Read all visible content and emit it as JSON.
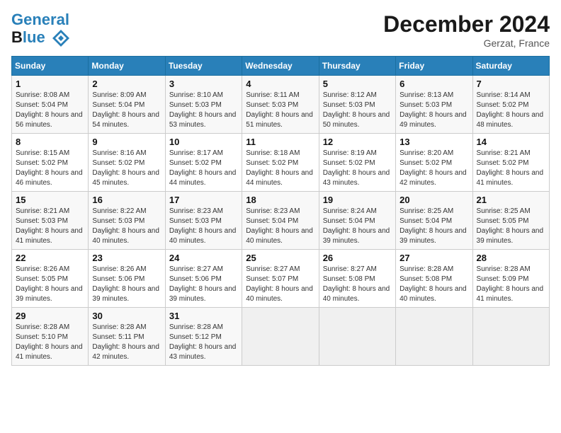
{
  "header": {
    "logo_line1": "General",
    "logo_line2": "Blue",
    "title": "December 2024",
    "subtitle": "Gerzat, France"
  },
  "weekdays": [
    "Sunday",
    "Monday",
    "Tuesday",
    "Wednesday",
    "Thursday",
    "Friday",
    "Saturday"
  ],
  "weeks": [
    [
      {
        "day": "1",
        "sunrise": "Sunrise: 8:08 AM",
        "sunset": "Sunset: 5:04 PM",
        "daylight": "Daylight: 8 hours and 56 minutes."
      },
      {
        "day": "2",
        "sunrise": "Sunrise: 8:09 AM",
        "sunset": "Sunset: 5:04 PM",
        "daylight": "Daylight: 8 hours and 54 minutes."
      },
      {
        "day": "3",
        "sunrise": "Sunrise: 8:10 AM",
        "sunset": "Sunset: 5:03 PM",
        "daylight": "Daylight: 8 hours and 53 minutes."
      },
      {
        "day": "4",
        "sunrise": "Sunrise: 8:11 AM",
        "sunset": "Sunset: 5:03 PM",
        "daylight": "Daylight: 8 hours and 51 minutes."
      },
      {
        "day": "5",
        "sunrise": "Sunrise: 8:12 AM",
        "sunset": "Sunset: 5:03 PM",
        "daylight": "Daylight: 8 hours and 50 minutes."
      },
      {
        "day": "6",
        "sunrise": "Sunrise: 8:13 AM",
        "sunset": "Sunset: 5:03 PM",
        "daylight": "Daylight: 8 hours and 49 minutes."
      },
      {
        "day": "7",
        "sunrise": "Sunrise: 8:14 AM",
        "sunset": "Sunset: 5:02 PM",
        "daylight": "Daylight: 8 hours and 48 minutes."
      }
    ],
    [
      {
        "day": "8",
        "sunrise": "Sunrise: 8:15 AM",
        "sunset": "Sunset: 5:02 PM",
        "daylight": "Daylight: 8 hours and 46 minutes."
      },
      {
        "day": "9",
        "sunrise": "Sunrise: 8:16 AM",
        "sunset": "Sunset: 5:02 PM",
        "daylight": "Daylight: 8 hours and 45 minutes."
      },
      {
        "day": "10",
        "sunrise": "Sunrise: 8:17 AM",
        "sunset": "Sunset: 5:02 PM",
        "daylight": "Daylight: 8 hours and 44 minutes."
      },
      {
        "day": "11",
        "sunrise": "Sunrise: 8:18 AM",
        "sunset": "Sunset: 5:02 PM",
        "daylight": "Daylight: 8 hours and 44 minutes."
      },
      {
        "day": "12",
        "sunrise": "Sunrise: 8:19 AM",
        "sunset": "Sunset: 5:02 PM",
        "daylight": "Daylight: 8 hours and 43 minutes."
      },
      {
        "day": "13",
        "sunrise": "Sunrise: 8:20 AM",
        "sunset": "Sunset: 5:02 PM",
        "daylight": "Daylight: 8 hours and 42 minutes."
      },
      {
        "day": "14",
        "sunrise": "Sunrise: 8:21 AM",
        "sunset": "Sunset: 5:02 PM",
        "daylight": "Daylight: 8 hours and 41 minutes."
      }
    ],
    [
      {
        "day": "15",
        "sunrise": "Sunrise: 8:21 AM",
        "sunset": "Sunset: 5:03 PM",
        "daylight": "Daylight: 8 hours and 41 minutes."
      },
      {
        "day": "16",
        "sunrise": "Sunrise: 8:22 AM",
        "sunset": "Sunset: 5:03 PM",
        "daylight": "Daylight: 8 hours and 40 minutes."
      },
      {
        "day": "17",
        "sunrise": "Sunrise: 8:23 AM",
        "sunset": "Sunset: 5:03 PM",
        "daylight": "Daylight: 8 hours and 40 minutes."
      },
      {
        "day": "18",
        "sunrise": "Sunrise: 8:23 AM",
        "sunset": "Sunset: 5:04 PM",
        "daylight": "Daylight: 8 hours and 40 minutes."
      },
      {
        "day": "19",
        "sunrise": "Sunrise: 8:24 AM",
        "sunset": "Sunset: 5:04 PM",
        "daylight": "Daylight: 8 hours and 39 minutes."
      },
      {
        "day": "20",
        "sunrise": "Sunrise: 8:25 AM",
        "sunset": "Sunset: 5:04 PM",
        "daylight": "Daylight: 8 hours and 39 minutes."
      },
      {
        "day": "21",
        "sunrise": "Sunrise: 8:25 AM",
        "sunset": "Sunset: 5:05 PM",
        "daylight": "Daylight: 8 hours and 39 minutes."
      }
    ],
    [
      {
        "day": "22",
        "sunrise": "Sunrise: 8:26 AM",
        "sunset": "Sunset: 5:05 PM",
        "daylight": "Daylight: 8 hours and 39 minutes."
      },
      {
        "day": "23",
        "sunrise": "Sunrise: 8:26 AM",
        "sunset": "Sunset: 5:06 PM",
        "daylight": "Daylight: 8 hours and 39 minutes."
      },
      {
        "day": "24",
        "sunrise": "Sunrise: 8:27 AM",
        "sunset": "Sunset: 5:06 PM",
        "daylight": "Daylight: 8 hours and 39 minutes."
      },
      {
        "day": "25",
        "sunrise": "Sunrise: 8:27 AM",
        "sunset": "Sunset: 5:07 PM",
        "daylight": "Daylight: 8 hours and 40 minutes."
      },
      {
        "day": "26",
        "sunrise": "Sunrise: 8:27 AM",
        "sunset": "Sunset: 5:08 PM",
        "daylight": "Daylight: 8 hours and 40 minutes."
      },
      {
        "day": "27",
        "sunrise": "Sunrise: 8:28 AM",
        "sunset": "Sunset: 5:08 PM",
        "daylight": "Daylight: 8 hours and 40 minutes."
      },
      {
        "day": "28",
        "sunrise": "Sunrise: 8:28 AM",
        "sunset": "Sunset: 5:09 PM",
        "daylight": "Daylight: 8 hours and 41 minutes."
      }
    ],
    [
      {
        "day": "29",
        "sunrise": "Sunrise: 8:28 AM",
        "sunset": "Sunset: 5:10 PM",
        "daylight": "Daylight: 8 hours and 41 minutes."
      },
      {
        "day": "30",
        "sunrise": "Sunrise: 8:28 AM",
        "sunset": "Sunset: 5:11 PM",
        "daylight": "Daylight: 8 hours and 42 minutes."
      },
      {
        "day": "31",
        "sunrise": "Sunrise: 8:28 AM",
        "sunset": "Sunset: 5:12 PM",
        "daylight": "Daylight: 8 hours and 43 minutes."
      },
      null,
      null,
      null,
      null
    ]
  ]
}
